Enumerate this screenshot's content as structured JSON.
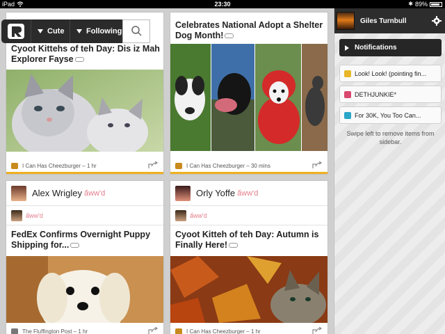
{
  "status_bar": {
    "device": "iPad",
    "time": "23:30",
    "battery": "89%",
    "battery_level": 0.89
  },
  "nav": {
    "logo_icon": "r-logo-icon",
    "filter_label": "Cute",
    "stream_label": "Following",
    "search_icon": "search-icon"
  },
  "cards": {
    "c1": {
      "title": "Cyoot Kittehs of teh Day: Dis iz Mah Explorer Fayse",
      "source": "I Can Has Cheezburger – 1 hr"
    },
    "c2": {
      "title": "Celebrates National Adopt a Shelter Dog Month!",
      "source": "I Can Has Cheezburger – 30 mins"
    },
    "c3": {
      "user": "Alex Wrigley",
      "action": "ấww'd",
      "sub_action": "ấww'd",
      "title": "FedEx Confirms Overnight Puppy Shipping for...",
      "source": "The Fluffington Post – 1 hr"
    },
    "c4": {
      "user": "Orly Yoffe",
      "action": "ấww'd",
      "sub_action": "ấww'd",
      "title": "Cyoot Kitteh of teh Day: Autumn is Finally Here!",
      "source": "I Can Has Cheezburger – 1 hr"
    }
  },
  "sidebar": {
    "user_name": "Giles Turnbull",
    "gear_icon": "gear-icon",
    "notifications_label": "Notifications",
    "items": [
      {
        "label": "Look! Look! (pointing fin...",
        "icon_color": "#e8b628"
      },
      {
        "label": "DETHJUNKIE*",
        "icon_color": "#d9486e"
      },
      {
        "label": "For 30K, You Too Can...",
        "icon_color": "#2aa6c8"
      }
    ],
    "hint": "Swipe left to remove items from sidebar."
  },
  "colors": {
    "accent": "#f0b020",
    "aww": "#e27c8a",
    "dark": "#2b2b2b"
  }
}
